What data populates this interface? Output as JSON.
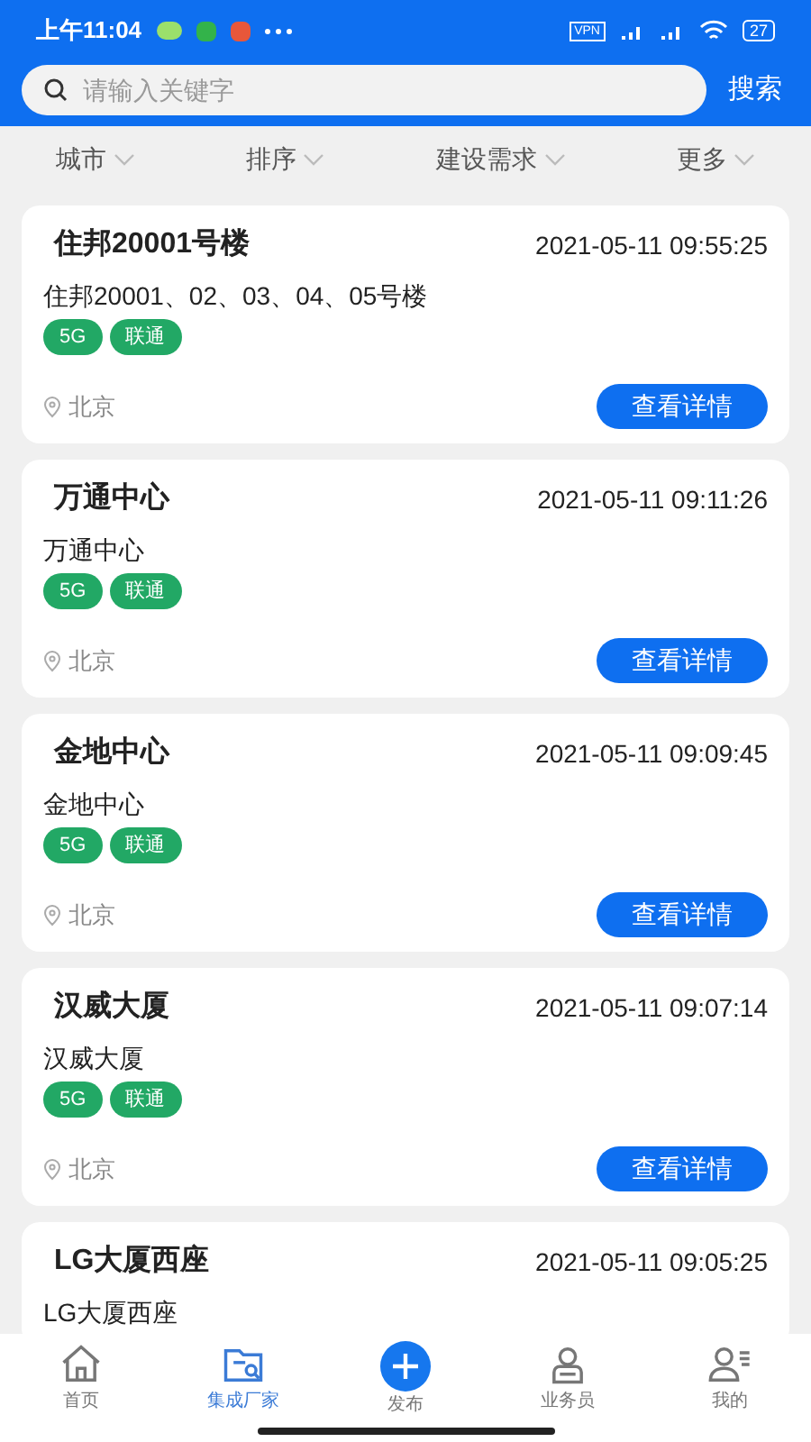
{
  "status_bar": {
    "time": "上午11:04",
    "vpn": "VPN",
    "battery": "27"
  },
  "search": {
    "placeholder": "请输入关键字",
    "button": "搜索"
  },
  "filters": [
    {
      "label": "城市"
    },
    {
      "label": "排序"
    },
    {
      "label": "建设需求"
    },
    {
      "label": "更多"
    }
  ],
  "cards": [
    {
      "title": "住邦20001号楼",
      "time": "2021-05-11 09:55:25",
      "subtitle": "住邦20001、02、03、04、05号楼",
      "tags": [
        "5G",
        "联通"
      ],
      "location": "北京",
      "button": "查看详情"
    },
    {
      "title": "万通中心",
      "time": "2021-05-11 09:11:26",
      "subtitle": "万通中心",
      "tags": [
        "5G",
        "联通"
      ],
      "location": "北京",
      "button": "查看详情"
    },
    {
      "title": "金地中心",
      "time": "2021-05-11 09:09:45",
      "subtitle": "金地中心",
      "tags": [
        "5G",
        "联通"
      ],
      "location": "北京",
      "button": "查看详情"
    },
    {
      "title": "汉威大厦",
      "time": "2021-05-11 09:07:14",
      "subtitle": "汉威大厦",
      "tags": [
        "5G",
        "联通"
      ],
      "location": "北京",
      "button": "查看详情"
    },
    {
      "title": "LG大厦西座",
      "time": "2021-05-11 09:05:25",
      "subtitle": "LG大厦西座"
    }
  ],
  "nav": [
    {
      "label": "首页",
      "kind": "home",
      "selected": false
    },
    {
      "label": "集成厂家",
      "kind": "vendor",
      "selected": true
    },
    {
      "label": "发布",
      "kind": "publish",
      "selected": false
    },
    {
      "label": "业务员",
      "kind": "staff",
      "selected": false
    },
    {
      "label": "我的",
      "kind": "me",
      "selected": false
    }
  ]
}
